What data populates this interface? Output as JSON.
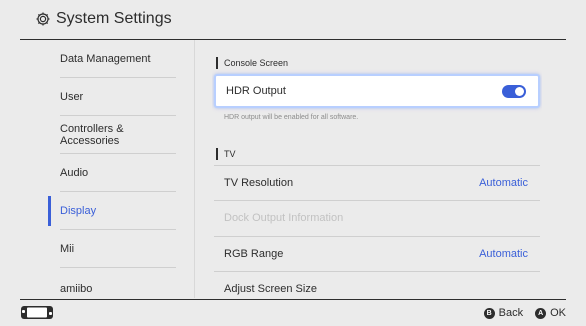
{
  "header": {
    "title": "System Settings",
    "icon": "gear-icon"
  },
  "sidebar": {
    "items": [
      {
        "label": "Data Management"
      },
      {
        "label": "User"
      },
      {
        "label": "Controllers & Accessories"
      },
      {
        "label": "Audio"
      },
      {
        "label": "Display",
        "active": true
      },
      {
        "label": "Mii"
      },
      {
        "label": "amiibo"
      }
    ]
  },
  "content": {
    "console_screen": {
      "label": "Console Screen",
      "hdr_output": {
        "label": "HDR Output",
        "enabled": true
      },
      "note": "HDR output will be enabled for all software."
    },
    "tv": {
      "label": "TV",
      "rows": [
        {
          "label": "TV Resolution",
          "value": "Automatic"
        },
        {
          "label": "Dock Output Information",
          "disabled": true
        },
        {
          "label": "RGB Range",
          "value": "Automatic"
        },
        {
          "label": "Adjust Screen Size"
        }
      ]
    }
  },
  "footer": {
    "back": {
      "button": "B",
      "label": "Back"
    },
    "ok": {
      "button": "A",
      "label": "OK"
    }
  },
  "colors": {
    "accent": "#3a5fd8",
    "background": "#ebebeb",
    "text": "#2d2d2d",
    "disabled": "#c2c2c2"
  }
}
